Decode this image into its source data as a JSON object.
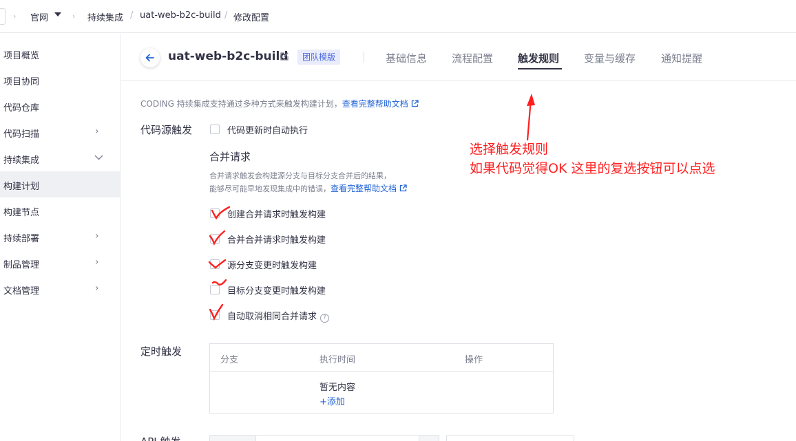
{
  "breadcrumb": {
    "team": "官网",
    "module": "持续集成",
    "job": "uat-web-b2c-build",
    "page": "修改配置"
  },
  "sidebar": {
    "items": [
      {
        "label": "项目概览",
        "has_arrow": false
      },
      {
        "label": "项目协同",
        "has_arrow": false
      },
      {
        "label": "代码仓库",
        "has_arrow": false
      },
      {
        "label": "代码扫描",
        "has_arrow": true,
        "arrow": "›"
      },
      {
        "label": "持续集成",
        "has_arrow": true,
        "arrow": "⌄"
      },
      {
        "label": "构建计划",
        "has_arrow": false,
        "active": true
      },
      {
        "label": "构建节点",
        "has_arrow": false
      },
      {
        "label": "持续部署",
        "has_arrow": true,
        "arrow": "›"
      },
      {
        "label": "制品管理",
        "has_arrow": true,
        "arrow": "›"
      },
      {
        "label": "文档管理",
        "has_arrow": true,
        "arrow": "›"
      }
    ]
  },
  "header": {
    "title": "uat-web-b2c-build",
    "badge": "团队模版",
    "tabs": [
      "基础信息",
      "流程配置",
      "触发规则",
      "变量与缓存",
      "通知提醒"
    ],
    "active_tab": "触发规则"
  },
  "content": {
    "intro_text": "CODING 持续集成支持通过多种方式来触发构建计划，",
    "intro_link": "查看完整帮助文档",
    "code_trigger_label": "代码源触发",
    "auto_run_label": "代码更新时自动执行",
    "merge_title": "合并请求",
    "merge_desc_line1": "合并请求触发会构建源分支与目标分支合并后的结果，",
    "merge_desc_line2": "能够尽可能早地发现集成中的错误，",
    "merge_link": "查看完整帮助文档",
    "merge_options": [
      "创建合并请求时触发构建",
      "合并合并请求时触发构建",
      "源分支变更时触发构建",
      "目标分支变更时触发构建",
      "自动取消相同合并请求"
    ],
    "timer_label": "定时触发",
    "table_headers": [
      "分支",
      "执行时间",
      "操作"
    ],
    "table_empty": "暂无内容",
    "table_add": "+添加",
    "api_label": "API 触发"
  },
  "annotation": {
    "line1": "选择触发规则",
    "line2": "如果代码觉得OK 这里的复选按钮可以点选",
    "color": "#ff1f1f"
  },
  "colors": {
    "link": "#2364d6",
    "badge_bg": "#e8ecfb",
    "badge_text": "#4d6ae0",
    "sidebar_active": "#eef0f4"
  }
}
